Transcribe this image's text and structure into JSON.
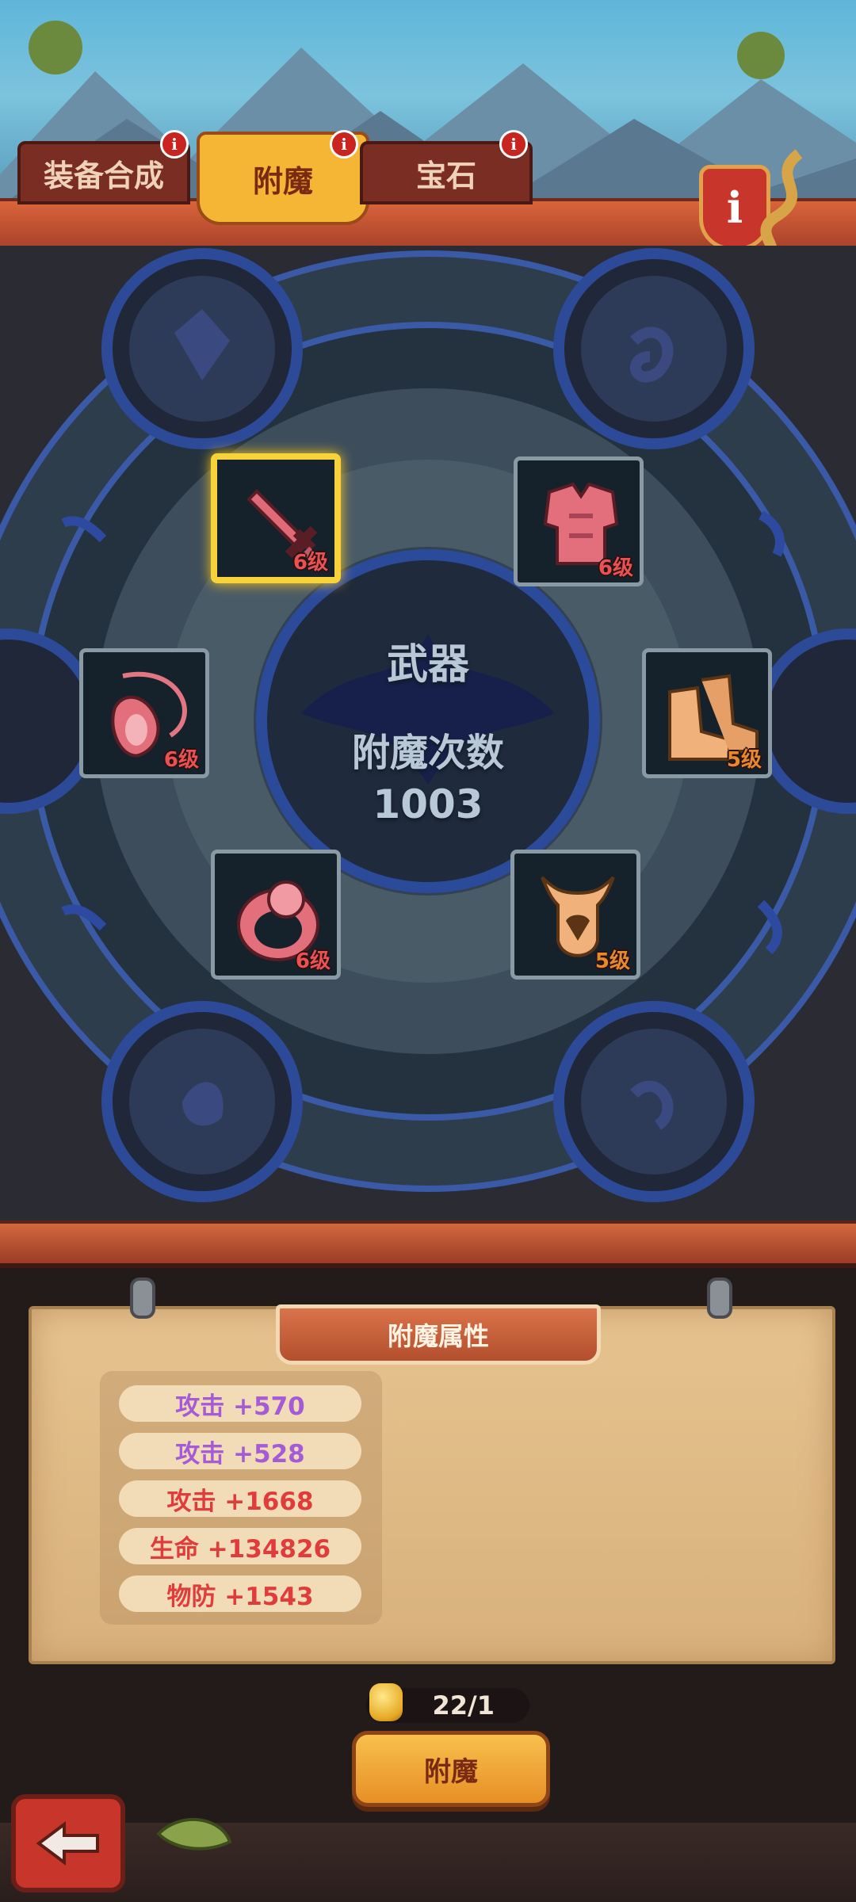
{
  "tabs": [
    {
      "label": "装备合成",
      "active": false,
      "badge": "i"
    },
    {
      "label": "附魔",
      "active": true,
      "badge": "i"
    },
    {
      "label": "宝石",
      "active": false,
      "badge": "i"
    }
  ],
  "info_button": "i",
  "center": {
    "slot_name": "武器",
    "count_label": "附魔次数",
    "count_value": "1003"
  },
  "equipment_slots": [
    {
      "item": "sword",
      "level": "6级",
      "selected": true
    },
    {
      "item": "chest-armor",
      "level": "6级",
      "selected": false
    },
    {
      "item": "necklace",
      "level": "6级",
      "selected": false
    },
    {
      "item": "boots",
      "level": "5级",
      "selected": false
    },
    {
      "item": "ring",
      "level": "6级",
      "selected": false
    },
    {
      "item": "helmet",
      "level": "5级",
      "selected": false
    }
  ],
  "panel": {
    "title": "附魔属性",
    "attributes": [
      {
        "text": "攻击 +570",
        "color": "#a55bd6"
      },
      {
        "text": "攻击 +528",
        "color": "#a55bd6"
      },
      {
        "text": "攻击 +1668",
        "color": "#e03c3c"
      },
      {
        "text": "生命 +134826",
        "color": "#e03c3c"
      },
      {
        "text": "物防 +1543",
        "color": "#e03c3c"
      }
    ]
  },
  "cost": {
    "value": "22/1",
    "icon": "gold-coin-icon"
  },
  "enchant_button": "附魔",
  "back_icon": "back-arrow-icon"
}
